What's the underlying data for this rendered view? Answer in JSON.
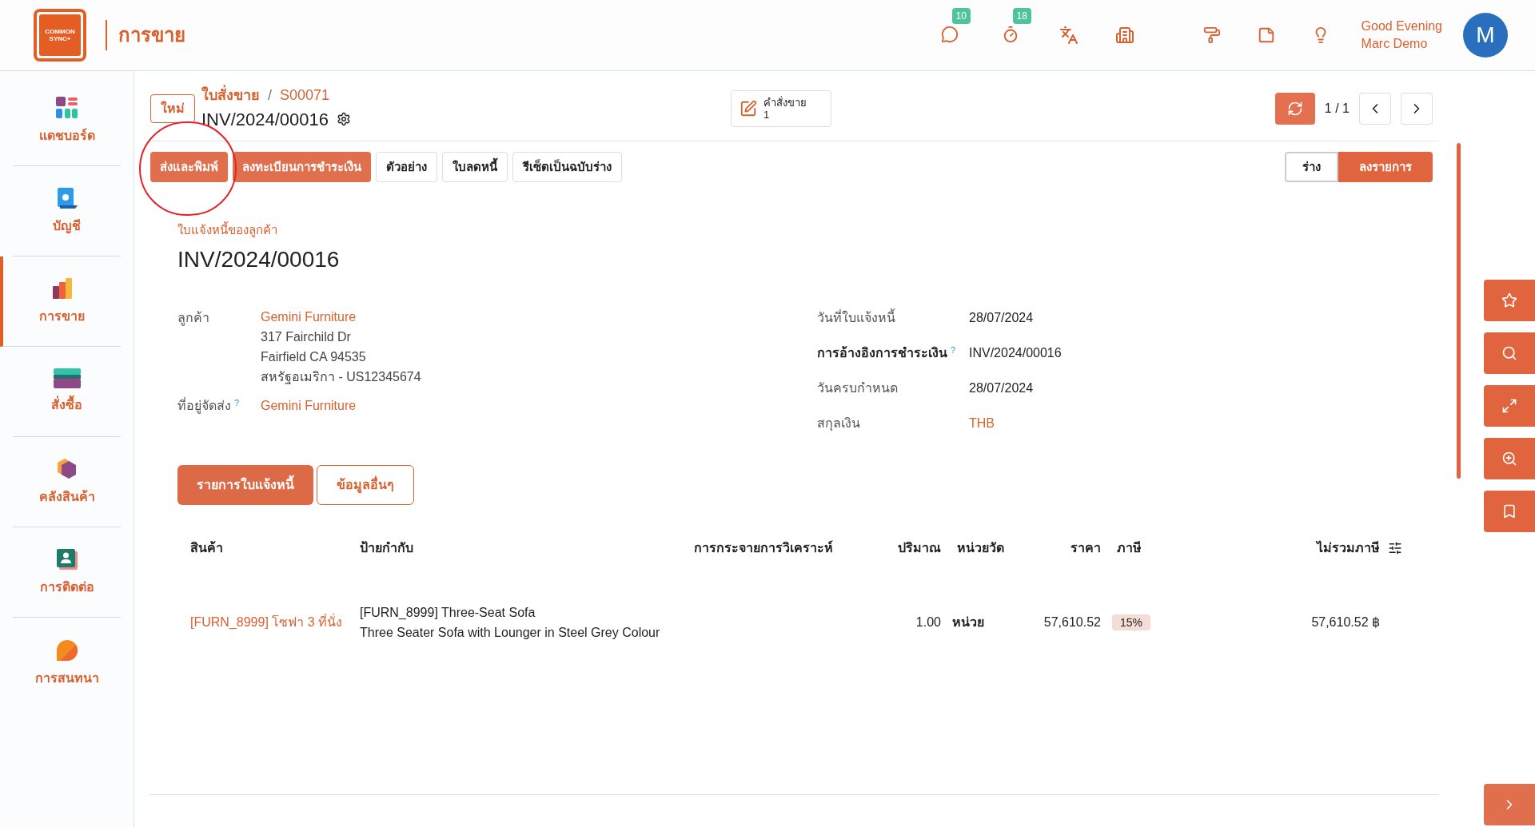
{
  "app": {
    "logo_line1": "COMMON",
    "logo_line2": "SYNC+",
    "module_title": "การขาย"
  },
  "topbar": {
    "badges": [
      {
        "count": "10"
      },
      {
        "count": "18"
      }
    ],
    "greeting": "Good Evening",
    "user": "Marc Demo",
    "avatar": "M"
  },
  "sidebar": {
    "items": [
      {
        "label": "แดชบอร์ด",
        "selected": false
      },
      {
        "label": "บัญชี",
        "selected": false
      },
      {
        "label": "การขาย",
        "selected": true
      },
      {
        "label": "สั่งซื้อ",
        "selected": false
      },
      {
        "label": "คลังสินค้า",
        "selected": false
      },
      {
        "label": "การติดต่อ",
        "selected": false
      },
      {
        "label": "การสนทนา",
        "selected": false
      }
    ]
  },
  "header": {
    "new_button": "ใหม่",
    "breadcrumb": [
      "ใบสั่งขาย",
      "S00071"
    ],
    "breadcrumb_separator": "/",
    "record_title": "INV/2024/00016",
    "smart_button": {
      "label": "คำสั่งขาย",
      "count": "1"
    },
    "pager": "1 / 1"
  },
  "actions": [
    {
      "label": "ส่งและพิมพ์",
      "kind": "primary"
    },
    {
      "label": "ลงทะเบียนการชำระเงิน",
      "kind": "primary"
    },
    {
      "label": "ตัวอย่าง",
      "kind": "secondary"
    },
    {
      "label": "ใบลดหนี้",
      "kind": "secondary"
    },
    {
      "label": "รีเซ็ตเป็นฉบับร่าง",
      "kind": "secondary"
    }
  ],
  "status": [
    {
      "label": "ร่าง",
      "selected": false
    },
    {
      "label": "ลงรายการ",
      "selected": true
    }
  ],
  "form": {
    "type_label": "ใบแจ้งหนี้ของลูกค้า",
    "number": "INV/2024/00016",
    "customer_label": "ลูกค้า",
    "customer": "Gemini Furniture",
    "address": [
      "317 Fairchild Dr",
      "Fairfield CA 94535",
      "สหรัฐอเมริกา - US12345674"
    ],
    "delivery_label": "ที่อยู่จัดส่ง",
    "delivery_help": "?",
    "delivery": "Gemini Furniture",
    "right_fields": [
      {
        "label": "วันที่ใบแจ้งหนี้",
        "value": "28/07/2024",
        "bold": false,
        "link": false
      },
      {
        "label": "การอ้างอิงการชำระเงิน",
        "help": "?",
        "value": "INV/2024/00016",
        "bold": true,
        "link": false
      },
      {
        "label": "วันครบกำหนด",
        "value": "28/07/2024",
        "bold": false,
        "link": false
      },
      {
        "label": "สกุลเงิน",
        "value": "THB",
        "bold": false,
        "link": true
      }
    ]
  },
  "tabs": [
    {
      "label": "รายการใบแจ้งหนี้",
      "selected": true
    },
    {
      "label": "ข้อมูลอื่นๆ",
      "selected": false
    }
  ],
  "table": {
    "columns": [
      "สินค้า",
      "ป้ายกำกับ",
      "การกระจายการวิเคราะห์",
      "ปริมาณ",
      "หน่วยวัด",
      "ราคา",
      "ภาษี",
      "ไม่รวมภาษี"
    ],
    "rows": [
      {
        "product": "[FURN_8999] โซฟา 3 ที่นั่ง",
        "label": [
          "[FURN_8999] Three-Seat Sofa",
          "Three Seater Sofa with Lounger in Steel Grey Colour"
        ],
        "quantity": "1.00",
        "uom": "หน่วย",
        "price": "57,610.52",
        "tax": "15%",
        "subtotal": "57,610.52 ฿"
      }
    ]
  }
}
